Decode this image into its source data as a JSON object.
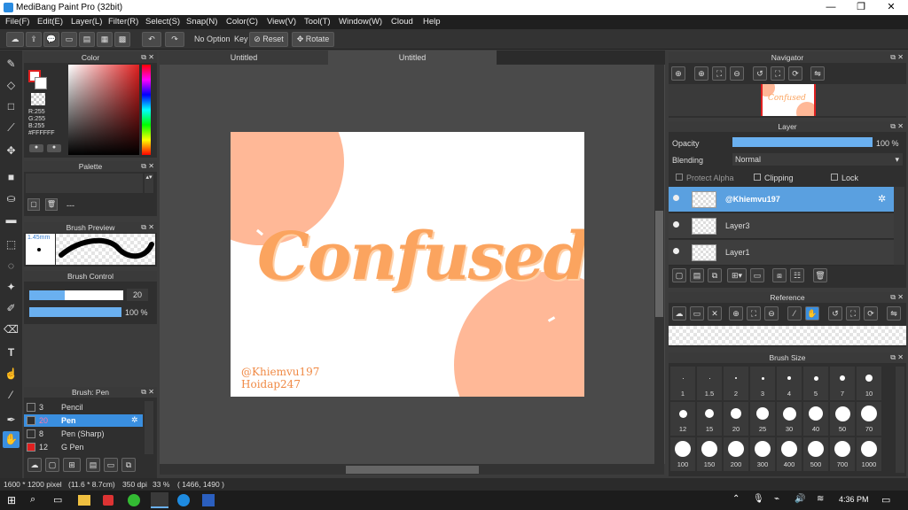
{
  "window": {
    "title": "MediBang Paint Pro (32bit)",
    "min": "—",
    "max": "❐",
    "close": "✕"
  },
  "menu": [
    "File(F)",
    "Edit(E)",
    "Layer(L)",
    "Filter(R)",
    "Select(S)",
    "Snap(N)",
    "Color(C)",
    "View(V)",
    "Tool(T)",
    "Window(W)",
    "Cloud",
    "Help"
  ],
  "toolbar": {
    "no_option": "No Option",
    "key": "Key",
    "reset": "Reset",
    "rotate": "Rotate"
  },
  "color_panel": {
    "title": "Color",
    "r": "R:255",
    "g": "G:255",
    "b": "B:255",
    "hex": "#FFFFFF"
  },
  "palette_panel": {
    "title": "Palette",
    "dash": "---"
  },
  "brush_preview": {
    "title": "Brush Preview",
    "size": "1.45mm"
  },
  "brush_control": {
    "title": "Brush Control",
    "size_value": "20",
    "size_fill": 0.38,
    "opacity_value": "100 %",
    "opacity_fill": 1.0
  },
  "brush_list": {
    "title": "Brush: Pen",
    "items": [
      {
        "num": "3",
        "name": "Pencil",
        "color": "#2f2f2f",
        "selected": false
      },
      {
        "num": "20",
        "name": "Pen",
        "color": "#2f2f2f",
        "selected": true
      },
      {
        "num": "8",
        "name": "Pen (Sharp)",
        "color": "#2f2f2f",
        "selected": false
      },
      {
        "num": "12",
        "name": "G Pen",
        "color": "#e02020",
        "selected": false
      }
    ]
  },
  "tabs": [
    {
      "label": "Untitled",
      "active": true
    },
    {
      "label": "Untitled",
      "active": false
    }
  ],
  "canvas": {
    "main_text": "Confused",
    "credit1": "@Khiemvu197",
    "credit2": "Hoidap247",
    "peach": "#ffb897",
    "orange": "#fba45f"
  },
  "navigator": {
    "title": "Navigator",
    "thumb_text": "Confused"
  },
  "layer_panel": {
    "title": "Layer",
    "opacity_label": "Opacity",
    "opacity_value": "100 %",
    "opacity_fill": 1.0,
    "blending_label": "Blending",
    "blending_value": "Normal",
    "protect_alpha": "Protect Alpha",
    "clipping": "Clipping",
    "lock": "Lock",
    "layers": [
      {
        "name": "@Khiemvu197",
        "selected": true
      },
      {
        "name": "Layer3",
        "selected": false
      },
      {
        "name": "Layer1",
        "selected": false
      }
    ]
  },
  "reference": {
    "title": "Reference"
  },
  "brush_size": {
    "title": "Brush Size",
    "row1": [
      "1",
      "1.5",
      "2",
      "3",
      "4",
      "5",
      "7",
      "10"
    ],
    "row2": [
      "12",
      "15",
      "20",
      "25",
      "30",
      "40",
      "50",
      "70"
    ],
    "row3": [
      "100",
      "150",
      "200",
      "300",
      "400",
      "500",
      "700",
      "1000"
    ]
  },
  "status": {
    "dims": "1600 * 1200 pixel",
    "cm": "(11.6 * 8.7cm)",
    "dpi": "350 dpi",
    "zoom": "33 %",
    "coords": "( 1466, 1490 )"
  },
  "taskbar": {
    "time": "4:36 PM"
  },
  "colors": {
    "accent": "#3a8fe0",
    "panel": "#2f2f2f",
    "canvas_bg": "#4a4a4a"
  }
}
